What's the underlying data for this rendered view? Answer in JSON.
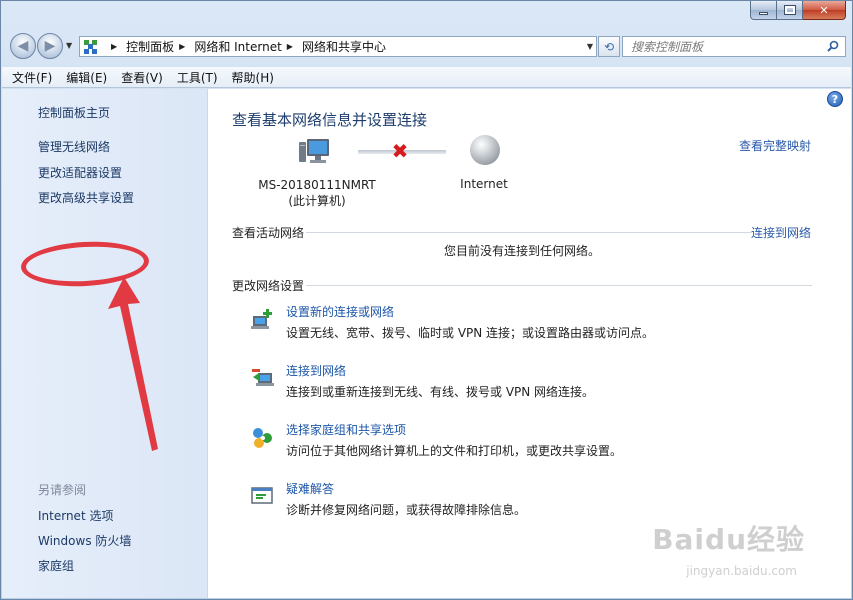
{
  "breadcrumb": [
    "控制面板",
    "网络和 Internet",
    "网络和共享中心"
  ],
  "search": {
    "placeholder": "搜索控制面板"
  },
  "menu": [
    "文件(F)",
    "编辑(E)",
    "查看(V)",
    "工具(T)",
    "帮助(H)"
  ],
  "sidebar": {
    "items": [
      "控制面板主页",
      "管理无线网络",
      "更改适配器设置",
      "更改高级共享设置"
    ],
    "see_also_heading": "另请参阅",
    "see_also": [
      "Internet 选项",
      "Windows 防火墙",
      "家庭组"
    ]
  },
  "main": {
    "title": "查看基本网络信息并设置连接",
    "full_map_link": "查看完整映射",
    "computer_name": "MS-20180111NMRT",
    "computer_sub": "(此计算机)",
    "internet_label": "Internet",
    "active_networks_title": "查看活动网络",
    "connect_link": "连接到网络",
    "no_network_text": "您目前没有连接到任何网络。",
    "change_settings_title": "更改网络设置",
    "tasks": [
      {
        "link": "设置新的连接或网络",
        "desc": "设置无线、宽带、拨号、临时或 VPN 连接；或设置路由器或访问点。"
      },
      {
        "link": "连接到网络",
        "desc": "连接到或重新连接到无线、有线、拨号或 VPN 网络连接。"
      },
      {
        "link": "选择家庭组和共享选项",
        "desc": "访问位于其他网络计算机上的文件和打印机，或更改共享设置。"
      },
      {
        "link": "疑难解答",
        "desc": "诊断并修复网络问题，或获得故障排除信息。"
      }
    ]
  },
  "watermark": {
    "brand": "Baidu经验",
    "sub": "jingyan.baidu.com"
  },
  "colors": {
    "link": "#1c56a8",
    "annotation": "#e23a43",
    "sidebar_bg": "#e6eefa"
  }
}
